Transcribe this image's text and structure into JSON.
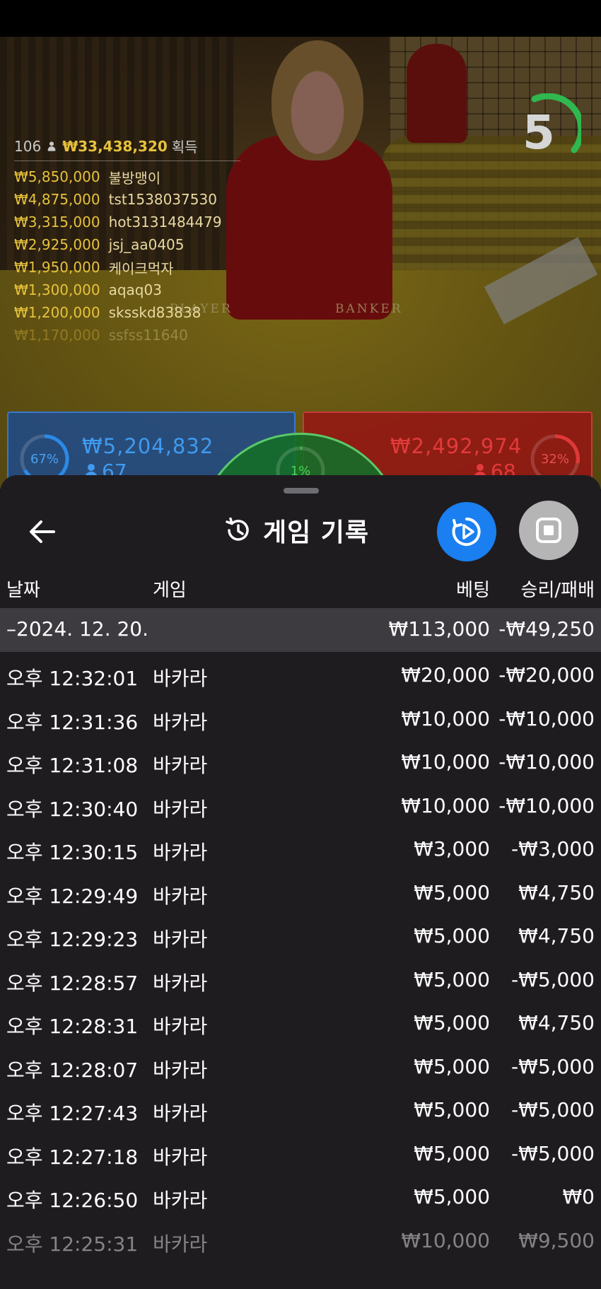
{
  "video": {
    "countdown": "5",
    "table_labels": {
      "player": "PLAYER",
      "banker": "BANKER"
    },
    "winners": {
      "total_count": "106",
      "total_amount": "₩33,438,320",
      "total_suffix": "획득",
      "list": [
        {
          "amount": "₩5,850,000",
          "name": "불방맹이"
        },
        {
          "amount": "₩4,875,000",
          "name": "tst1538037530"
        },
        {
          "amount": "₩3,315,000",
          "name": "hot3131484479"
        },
        {
          "amount": "₩2,925,000",
          "name": "jsj_aa0405"
        },
        {
          "amount": "₩1,950,000",
          "name": "케이크먹자"
        },
        {
          "amount": "₩1,300,000",
          "name": "aqaq03"
        },
        {
          "amount": "₩1,200,000",
          "name": "sksskd83838"
        },
        {
          "amount": "₩1,170,000",
          "name": "ssfss11640"
        }
      ]
    },
    "bets": {
      "player": {
        "percent": "67%",
        "amount": "₩5,204,832",
        "players": "67",
        "color": "#2a8ae8"
      },
      "tie": {
        "percent": "1%",
        "color": "#3ac94a"
      },
      "banker": {
        "percent": "32%",
        "amount": "₩2,492,974",
        "players": "68",
        "color": "#e03838"
      }
    }
  },
  "sheet": {
    "title": "게임 기록",
    "columns": {
      "date": "날짜",
      "game": "게임",
      "bet": "베팅",
      "win": "승리/패배"
    },
    "summary": {
      "date": "–2024. 12. 20.",
      "bet": "₩113,000",
      "win": "-₩49,250"
    },
    "rows": [
      {
        "time": "오후 12:32:01",
        "game": "바카라",
        "bet": "₩20,000",
        "win": "-₩20,000"
      },
      {
        "time": "오후 12:31:36",
        "game": "바카라",
        "bet": "₩10,000",
        "win": "-₩10,000"
      },
      {
        "time": "오후 12:31:08",
        "game": "바카라",
        "bet": "₩10,000",
        "win": "-₩10,000"
      },
      {
        "time": "오후 12:30:40",
        "game": "바카라",
        "bet": "₩10,000",
        "win": "-₩10,000"
      },
      {
        "time": "오후 12:30:15",
        "game": "바카라",
        "bet": "₩3,000",
        "win": "-₩3,000"
      },
      {
        "time": "오후 12:29:49",
        "game": "바카라",
        "bet": "₩5,000",
        "win": "₩4,750"
      },
      {
        "time": "오후 12:29:23",
        "game": "바카라",
        "bet": "₩5,000",
        "win": "₩4,750"
      },
      {
        "time": "오후 12:28:57",
        "game": "바카라",
        "bet": "₩5,000",
        "win": "-₩5,000"
      },
      {
        "time": "오후 12:28:31",
        "game": "바카라",
        "bet": "₩5,000",
        "win": "₩4,750"
      },
      {
        "time": "오후 12:28:07",
        "game": "바카라",
        "bet": "₩5,000",
        "win": "-₩5,000"
      },
      {
        "time": "오후 12:27:43",
        "game": "바카라",
        "bet": "₩5,000",
        "win": "-₩5,000"
      },
      {
        "time": "오후 12:27:18",
        "game": "바카라",
        "bet": "₩5,000",
        "win": "-₩5,000"
      },
      {
        "time": "오후 12:26:50",
        "game": "바카라",
        "bet": "₩5,000",
        "win": "₩0"
      },
      {
        "time": "오후 12:25:31",
        "game": "바카라",
        "bet": "₩10,000",
        "win": "₩9,500"
      }
    ]
  }
}
